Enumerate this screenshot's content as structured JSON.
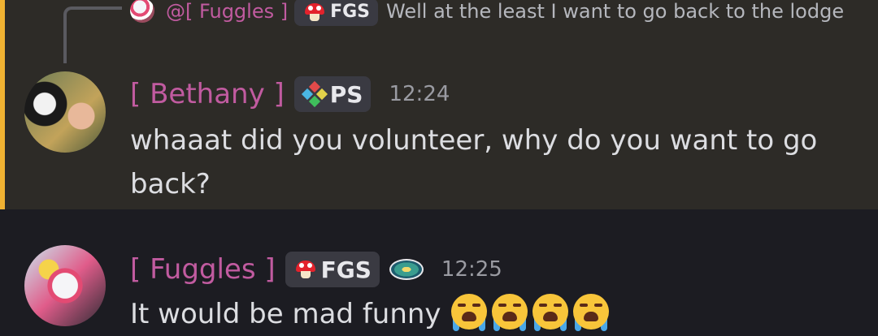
{
  "reply": {
    "mention": "@[ Fuggles ]",
    "badge_label": "FGS",
    "badge_icon": "mushroom-icon",
    "text": "Well at the least I want to go back to the lodge"
  },
  "messages": [
    {
      "author": "[ Bethany ]",
      "badge_label": "PS",
      "badge_icon": "four-diamond-icon",
      "time": "12:24",
      "text": "whaaat did you volunteer, why do you want to go back?",
      "highlighted": true
    },
    {
      "author": "[ Fuggles ]",
      "badge_label": "FGS",
      "badge_icon": "mushroom-icon",
      "server_icon": "server-emblem-icon",
      "time": "12:25",
      "text": "It would be mad funny",
      "emoji": [
        "loudly-crying-face",
        "loudly-crying-face",
        "loudly-crying-face",
        "loudly-crying-face"
      ]
    }
  ],
  "colors": {
    "background": "#1c1c22",
    "highlight_background": "#2d2b27",
    "highlight_bar": "#f0b232",
    "username": "#c15ba0",
    "text": "#dcdde1",
    "timestamp": "#9a9ba2"
  }
}
